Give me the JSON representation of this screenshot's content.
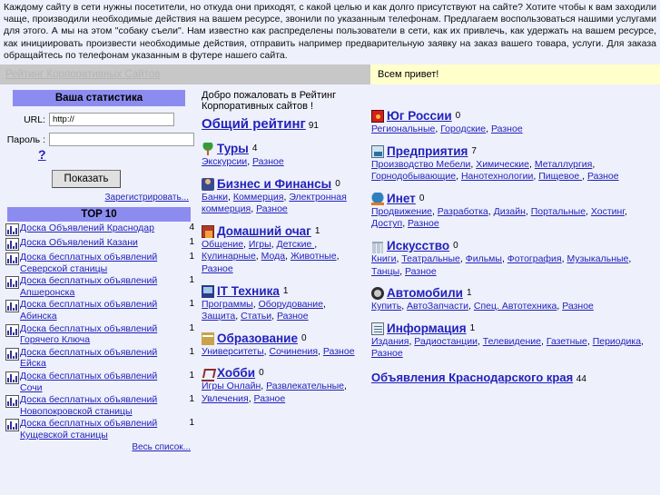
{
  "intro": {
    "text": "Каждому сайту в сети нужны посетители, но откуда они приходят, с какой целью и как долго присутствуют на сайте? Хотите чтобы к вам заходили чаще, производили необходимые действия на вашем ресурсе, звонили по указанным телефонам. Предлагаем воспользоваться нашими услугами для этого. А мы на этом \"собаку съели\". Нам известно как распределены пользователи в сети, как их привлечь, как удержать на вашем ресурсе, как инициировать произвести необходимые действия, отправить например предварительную заявку на заказ вашего товара, услуги. Для заказа обращайтесь по телефонам указанным в футере нашего сайта."
  },
  "header": {
    "site_link": "Рейтинг Корпоративных Сайтов",
    "greeting": "Всем привет!"
  },
  "sidebar": {
    "stats_title": "Ваша статистика",
    "url_label": "URL:",
    "url_value": "http://",
    "password_label": "Пароль :",
    "password_value": "",
    "help_link": "?",
    "show_button": "Показать",
    "register_link": "Зарегистрировать...",
    "top10_title": "TOP 10",
    "all_list_link": "Весь список...",
    "top10": [
      {
        "name": "Доска Объявлений Краснодар",
        "count": "4"
      },
      {
        "name": "Доска Объявлений Казани",
        "count": "1"
      },
      {
        "name": "Доска бесплатных объявлений Северской станицы",
        "count": "1"
      },
      {
        "name": "Доска бесплатных объявлений Апшеронска",
        "count": "1"
      },
      {
        "name": "Доска бесплатных объявлений Абинска",
        "count": "1"
      },
      {
        "name": "Доска бесплатных объявлений Горячего Ключа",
        "count": "1"
      },
      {
        "name": "Доска бесплатных объявлений Ейска",
        "count": "1"
      },
      {
        "name": "Доска бесплатных объявлений Сочи",
        "count": "1"
      },
      {
        "name": "Доска бесплатных объявлений Новопокровской станицы",
        "count": "1"
      },
      {
        "name": "Доска бесплатных объявлений Кущевской станицы",
        "count": "1"
      }
    ]
  },
  "main": {
    "welcome": "Добро пожаловать в Рейтинг Корпоративных сайтов !",
    "overall_rating": {
      "label": "Общий рейтинг",
      "count": "91"
    },
    "left_categories": [
      {
        "icon": "palm-tree-icon",
        "title": "Туры",
        "count": "4",
        "subs": [
          "Экскурсии",
          "Разное"
        ]
      },
      {
        "icon": "businessman-icon",
        "title": "Бизнес и Финансы",
        "count": "0",
        "subs": [
          "Банки",
          "Коммерция",
          "Электронная коммерция",
          "Разное"
        ]
      },
      {
        "icon": "fireplace-icon",
        "title": "Домашний очаг",
        "count": "1",
        "subs": [
          "Общение",
          "Игры",
          "Детские ",
          "Кулинарные",
          "Мода",
          "Животные",
          "Разное"
        ]
      },
      {
        "icon": "computer-icon",
        "title": "IT Техника",
        "count": "1",
        "subs": [
          "Программы",
          "Оборудование",
          "Защита",
          "Статьи",
          "Разное"
        ]
      },
      {
        "icon": "university-icon",
        "title": "Образование",
        "count": "0",
        "subs": [
          "Университеты",
          "Сочинения",
          "Разное"
        ]
      },
      {
        "icon": "rocking-chair-icon",
        "title": "Хобби",
        "count": "0",
        "subs": [
          "Игры Онлайн",
          "Развлекательные",
          "Увлечения",
          "Разное"
        ]
      }
    ],
    "right_categories": [
      {
        "icon": "flag-icon",
        "title": "Юг России",
        "count": "0",
        "subs": [
          "Региональные",
          "Городские",
          "Разное"
        ]
      },
      {
        "icon": "factory-icon",
        "title": "Предприятия",
        "count": "7",
        "subs": [
          "Производство Мебели",
          "Химические",
          "Металлургия",
          "Горнодобывающие",
          "Нанотехнологии",
          "Пищевое ",
          "Разное"
        ]
      },
      {
        "icon": "globe-www-icon",
        "title": "Инет",
        "count": "0",
        "subs": [
          "Продвижение",
          "Разработка",
          "Дизайн",
          "Портальные",
          "Хостинг",
          "Доступ",
          "Разное"
        ]
      },
      {
        "icon": "columns-icon",
        "title": "Искусство",
        "count": "0",
        "subs": [
          "Книги",
          "Театральные",
          "Фильмы",
          "Фотография",
          "Музыкальные",
          "Танцы",
          "Разное"
        ]
      },
      {
        "icon": "wheel-icon",
        "title": "Автомобили",
        "count": "1",
        "subs": [
          "Купить",
          "АвтоЗапчасти",
          "Спец. Автотехника",
          "Разное"
        ]
      },
      {
        "icon": "newspaper-icon",
        "title": "Информация",
        "count": "1",
        "subs": [
          "Издания",
          "Радиостанции",
          "Телевидение",
          "Газетные",
          "Периодика",
          "Разное"
        ]
      }
    ],
    "bottom_row": {
      "label": "Объявления Краснодарского края",
      "count": "44"
    }
  },
  "colors": {
    "panel_header": "#8c8cf0",
    "page_bg": "#eef0fb",
    "link": "#2222bb",
    "greeting_bg": "#ffffcc",
    "header_bg": "#c7c7c7"
  }
}
